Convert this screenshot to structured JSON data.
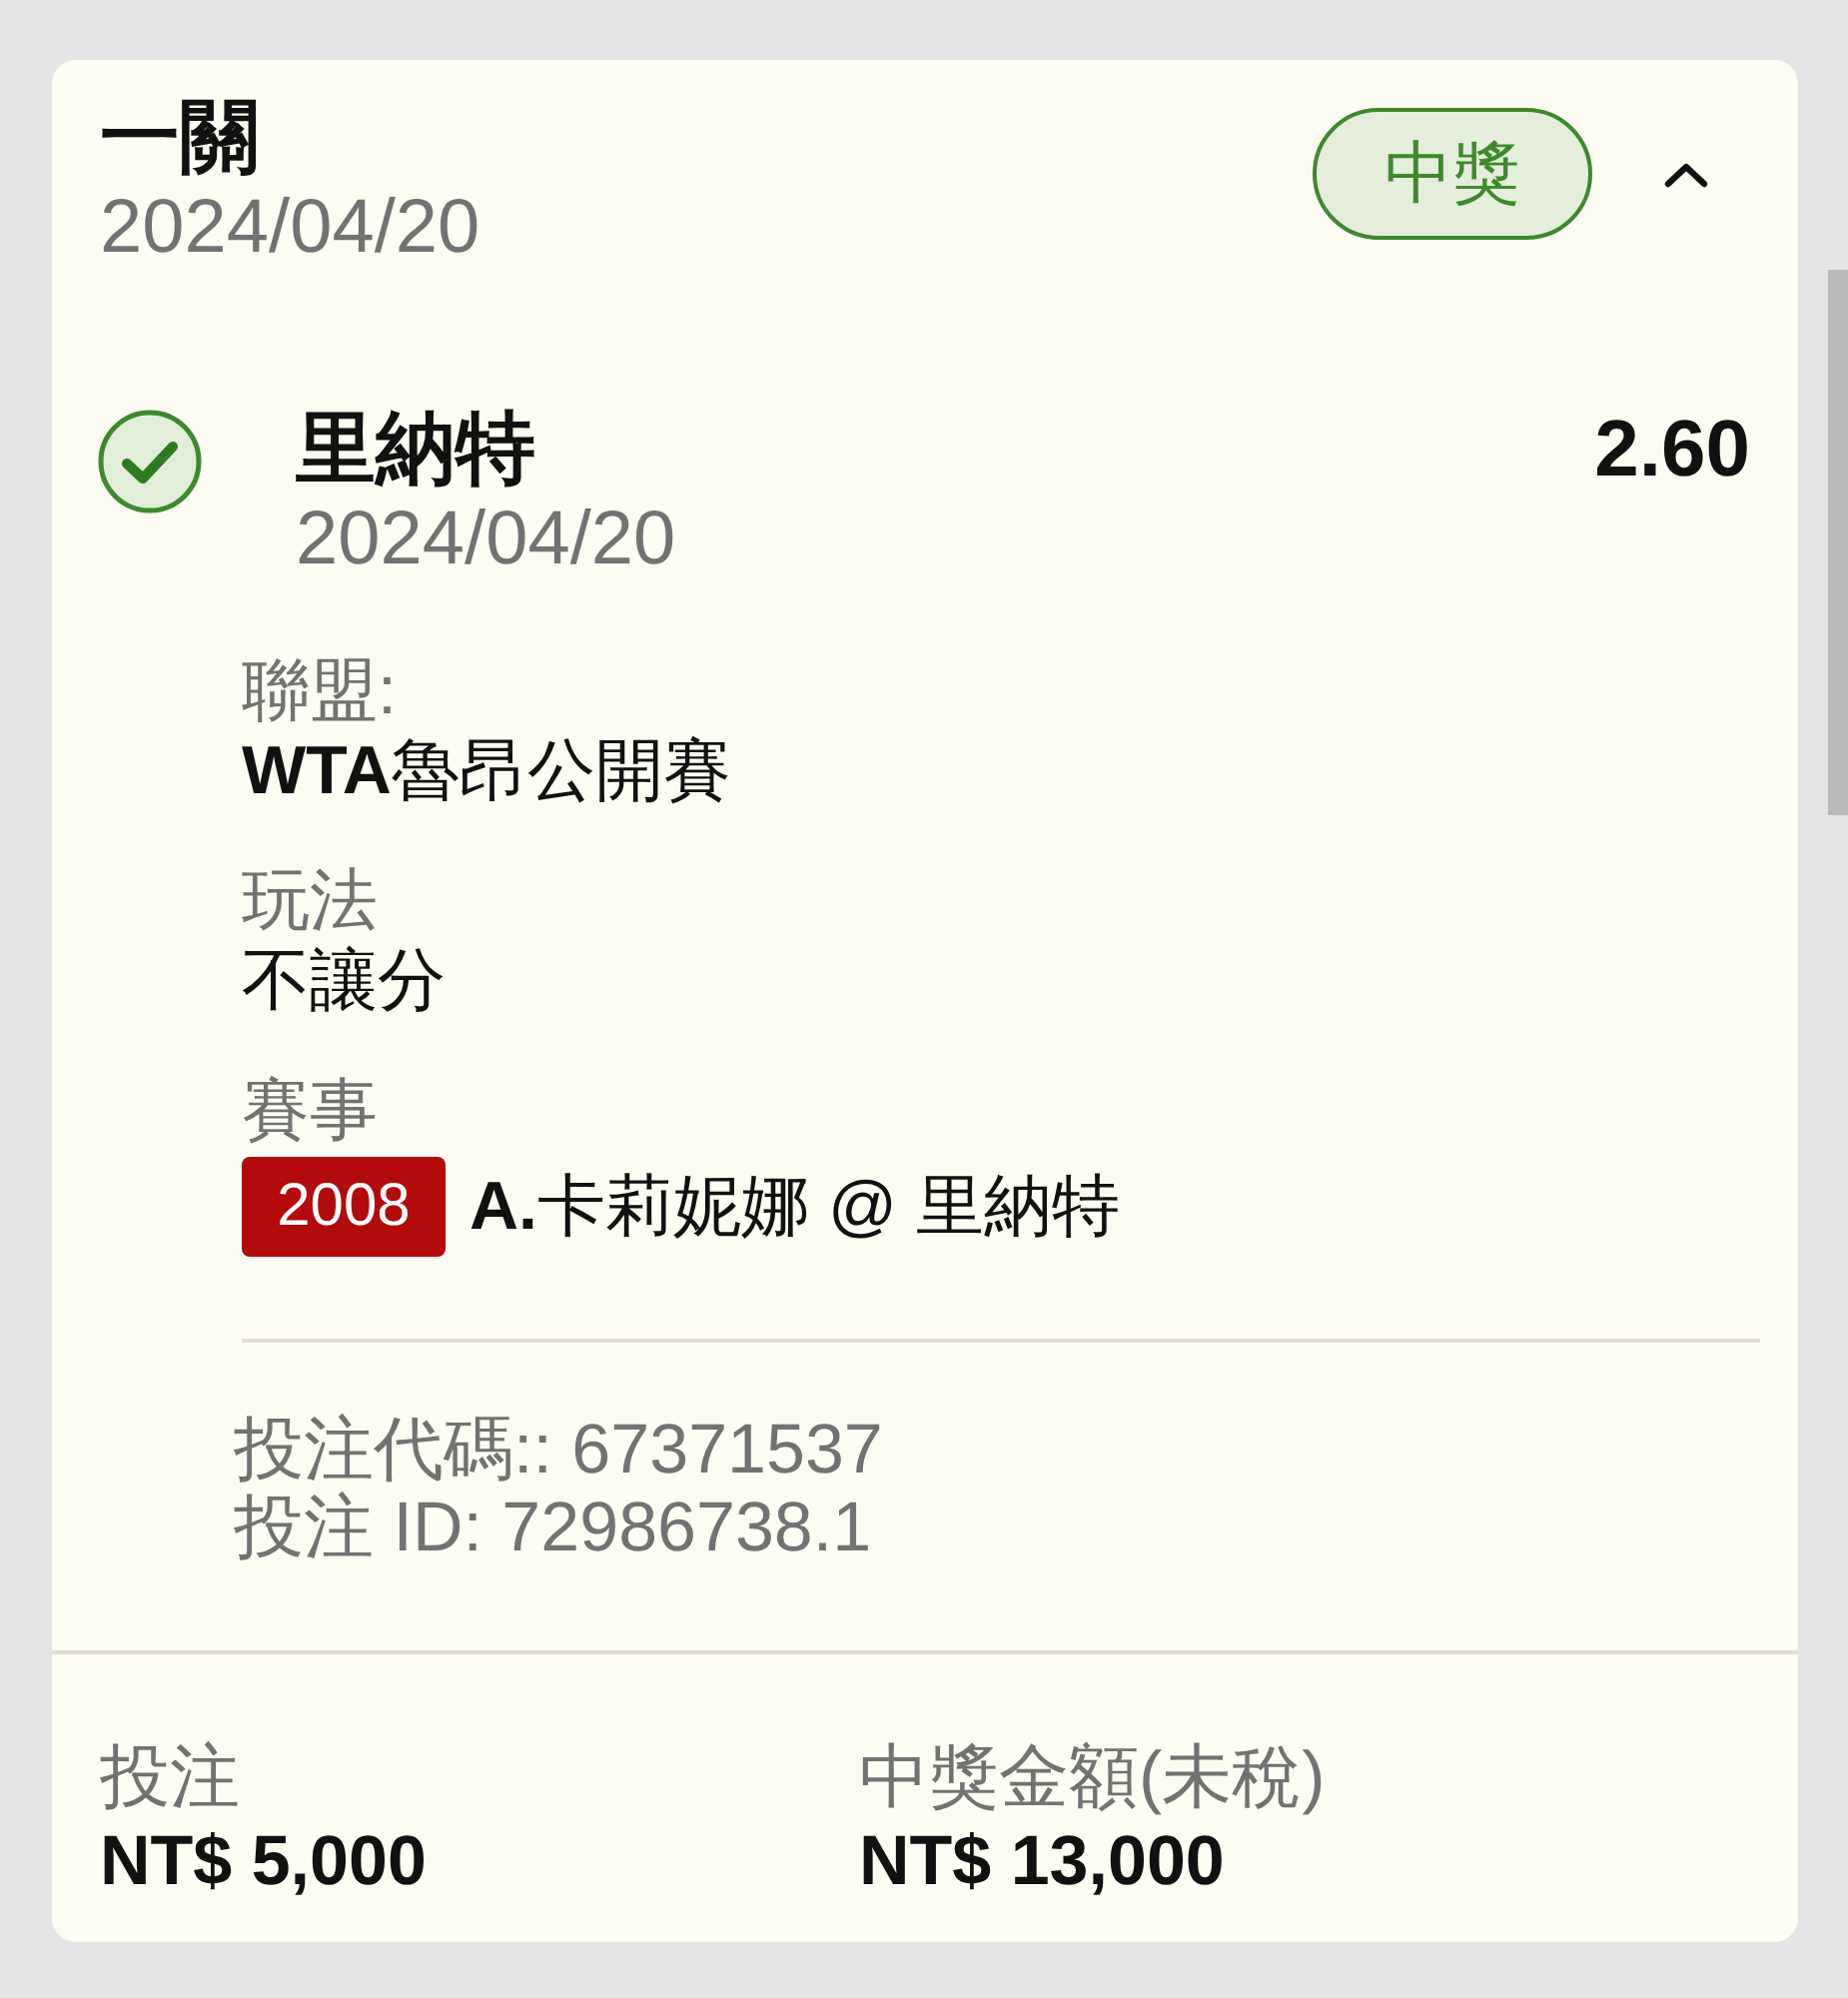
{
  "bet": {
    "title": "一關",
    "date": "2024/04/20",
    "status": {
      "label": "中獎",
      "kind": "won"
    },
    "expanded": true
  },
  "selection": {
    "won": true,
    "name": "里納特",
    "date": "2024/04/20",
    "odds": "2.60"
  },
  "details": [
    {
      "kind": "text",
      "label": "聯盟:",
      "value": "**WTA**魯昂公開賽"
    },
    {
      "kind": "text",
      "label": "玩法",
      "value": "不讓分"
    },
    {
      "kind": "event",
      "label": "賽事",
      "code": "2008",
      "value": "**A.**卡莉妮娜 @ 里納特"
    }
  ],
  "references": [
    "投注代碼:: 67371537",
    "投注 ID: 72986738.1"
  ],
  "summary": [
    {
      "label": "投注",
      "value": "NT$ 5,000"
    },
    {
      "label": "中獎金額(未稅)",
      "value": "NT$ 13,000"
    }
  ]
}
